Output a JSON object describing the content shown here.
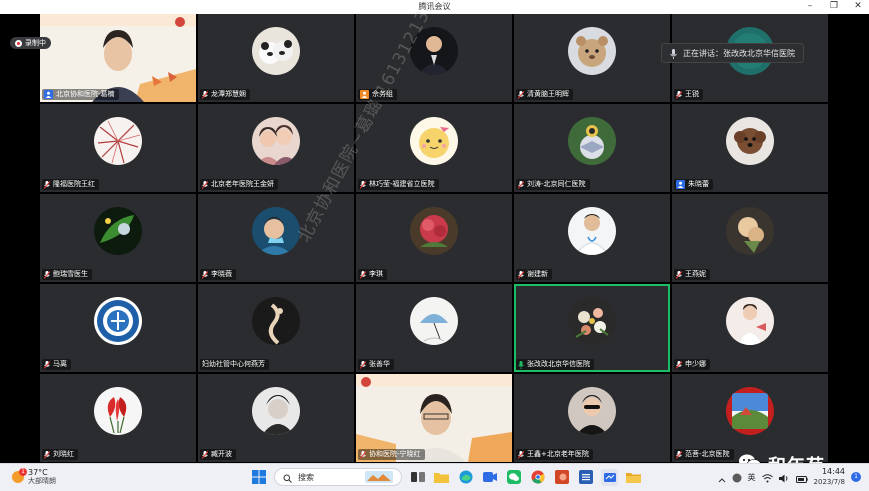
{
  "window": {
    "title": "腾讯会议"
  },
  "recording": {
    "label": "录制中"
  },
  "speaking": {
    "label": "正在讲话：",
    "name": "张改改北京华信医院"
  },
  "watermark": {
    "text": "北京协和医院~葛璐 16131213857707"
  },
  "brand": {
    "name": "和年苑"
  },
  "participants": [
    {
      "name": "北京协和医院-葛楠",
      "icon": "host"
    },
    {
      "name": "龙潭郑慧娴",
      "icon": "mic"
    },
    {
      "name": "佘务组",
      "icon": "host"
    },
    {
      "name": "清黄脑王明辉",
      "icon": "mic"
    },
    {
      "name": "王锐",
      "icon": "mic"
    },
    {
      "name": "隆福医院王红",
      "icon": "mic"
    },
    {
      "name": "北京老年医院王金妍",
      "icon": "mic"
    },
    {
      "name": "林巧莹-福建省立医院",
      "icon": "mic"
    },
    {
      "name": "刘涛-北京同仁医院",
      "icon": "mic"
    },
    {
      "name": "朱晓蕾",
      "icon": "host"
    },
    {
      "name": "鲍瑞雪医生",
      "icon": "mic"
    },
    {
      "name": "李晓薇",
      "icon": "mic"
    },
    {
      "name": "李琪",
      "icon": "mic"
    },
    {
      "name": "谢建新",
      "icon": "mic"
    },
    {
      "name": "王燕妮",
      "icon": "mic"
    },
    {
      "name": "马离",
      "icon": "mic"
    },
    {
      "name": "妇幼社管中心何燕芳",
      "icon": "none"
    },
    {
      "name": "张善华",
      "icon": "mic"
    },
    {
      "name": "张改改北京华信医院",
      "icon": "mic-green"
    },
    {
      "name": "申少娜",
      "icon": "mic"
    },
    {
      "name": "刘晓红",
      "icon": "mic"
    },
    {
      "name": "臧开波",
      "icon": "mic"
    },
    {
      "name": "协和医院-宁晓红",
      "icon": "mic"
    },
    {
      "name": "王鑫+北京老年医院",
      "icon": "mic"
    },
    {
      "name": "范菩-北京医院",
      "icon": "mic"
    }
  ],
  "taskbar": {
    "weather_temp": "37°C",
    "weather_cond": "大部晴朗",
    "weather_badge": "1",
    "search_placeholder": "搜索",
    "ime": "英",
    "time": "14:44",
    "date": "2023/7/8",
    "notifications": "1"
  },
  "colors": {
    "tile_bg": "#2b2c2f",
    "speaking_border": "#1fbd63",
    "host_blue": "#2e6be6",
    "host_orange": "#f08a24",
    "mic_red": "#e53935"
  }
}
